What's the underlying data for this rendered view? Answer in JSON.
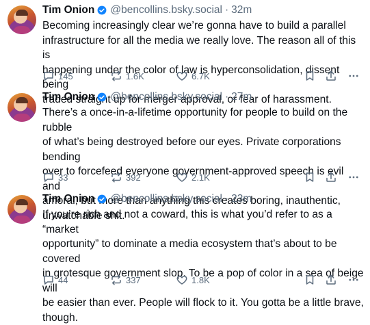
{
  "posts": [
    {
      "author": "Tim Onion",
      "handle": "@bencollins.bsky.social",
      "time": "32m",
      "text_lines": [
        "Becoming increasingly clear we’re gonna have to build a parallel",
        "infrastructure for all the media we really love. The reason all of this is",
        "happening under the color of law is hyperconsolidation, dissent being",
        "traded straight up for merger approval, or fear of harassment."
      ],
      "replies": "145",
      "reposts": "1.6K",
      "likes": "6.7K"
    },
    {
      "author": "Tim Onion",
      "handle": "@bencollins.bsky.social",
      "time": "27m",
      "text_lines": [
        "There’s a once-in-a-lifetime opportunity for people to build on the rubble",
        "of what’s being destroyed before our eyes. Private corporations bending",
        "over to forcefeed everyone government-approved speech is evil and",
        "amoral, but more than anything this creates boring, inauthentic,",
        "unwatchable shit."
      ],
      "replies": "33",
      "reposts": "392",
      "likes": "2.1K"
    },
    {
      "author": "Tim Onion",
      "handle": "@bencollins.bsky.social",
      "time": "23m",
      "text_lines": [
        "If you’re rich and not a coward, this is what you’d refer to as a “market",
        "opportunity” to dominate a media ecosystem that’s about to be covered",
        "in grotesque government slop. To be a pop of color in a sea of beige will",
        "be easier than ever. People will flock to it. You gotta be a little brave,",
        "though."
      ],
      "replies": "44",
      "reposts": "337",
      "likes": "1.8K"
    }
  ],
  "separator": "·",
  "icons": {
    "verified": "verified-badge-icon",
    "reply": "reply-bubble-icon",
    "repost": "repost-arrows-icon",
    "like": "heart-icon",
    "bookmark": "bookmark-icon",
    "share": "share-icon",
    "more": "more-dots-icon"
  },
  "colors": {
    "verified": "#1083fe",
    "muted": "#5b6b7c",
    "text": "#0b0f14"
  }
}
